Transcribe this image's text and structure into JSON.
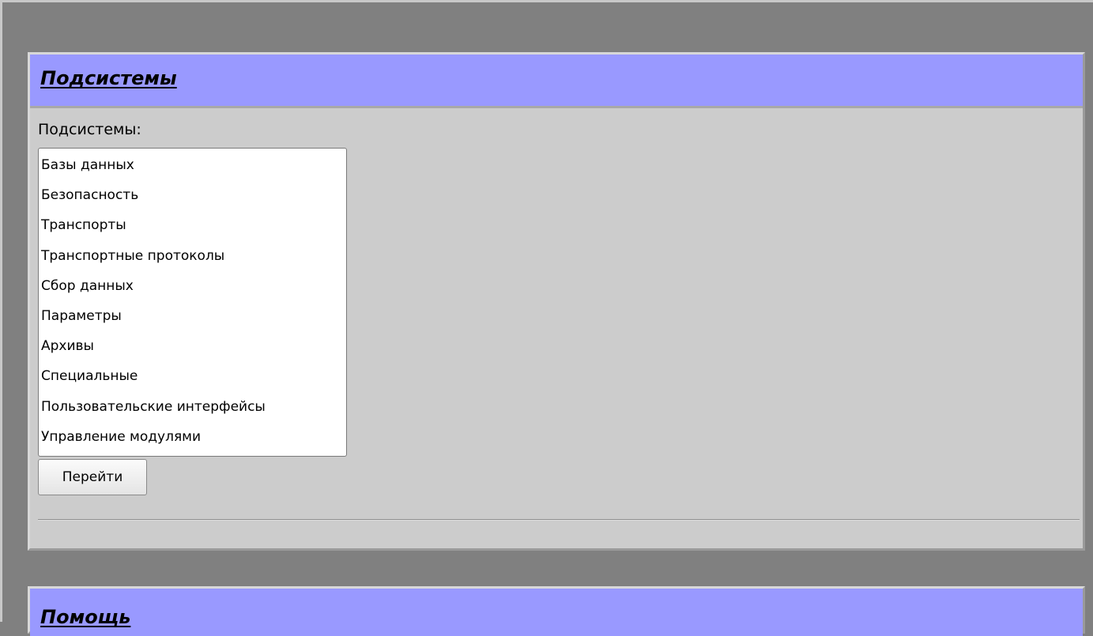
{
  "subsystems_panel": {
    "title": "Подсистемы",
    "list_label": "Подсистемы:",
    "items": [
      "Базы данных",
      "Безопасность",
      "Транспорты",
      "Транспортные протоколы",
      "Сбор данных",
      "Параметры",
      "Архивы",
      "Специальные",
      "Пользовательские интерфейсы",
      "Управление модулями"
    ],
    "goto_label": "Перейти"
  },
  "help_panel": {
    "title": "Помощь"
  },
  "colors": {
    "page_background": "#808080",
    "panel_background": "#cccccc",
    "header_background": "#9999ff"
  }
}
